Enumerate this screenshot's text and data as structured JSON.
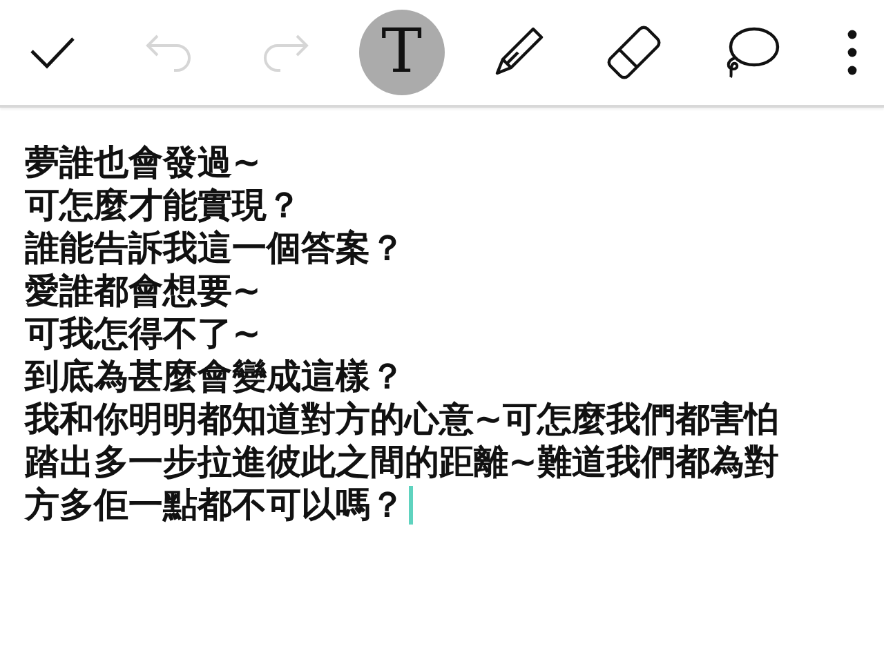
{
  "actions": [
    {
      "kind": "confirm",
      "disabled": false
    },
    {
      "kind": "undo",
      "disabled": true
    },
    {
      "kind": "redo",
      "disabled": true
    }
  ],
  "tools": [
    {
      "kind": "text",
      "glyph": "T",
      "selected": true
    },
    {
      "kind": "pen",
      "selected": false
    },
    {
      "kind": "eraser",
      "selected": false
    },
    {
      "kind": "lasso",
      "selected": false
    }
  ],
  "menu": {
    "kind": "more"
  },
  "editor": {
    "lines": [
      "夢誰也會發過~",
      "可怎麼才能實現？",
      "誰能告訴我這一個答案？",
      "愛誰都會想要~",
      "可我怎得不了~",
      "到底為甚麼會變成這樣？",
      "我和你明明都知道對方的心意~可怎麼我們都害怕",
      "踏出多一步拉進彼此之間的距離~難道我們都為對",
      "方多佢一點都不可以嗎？"
    ],
    "caret": true
  }
}
